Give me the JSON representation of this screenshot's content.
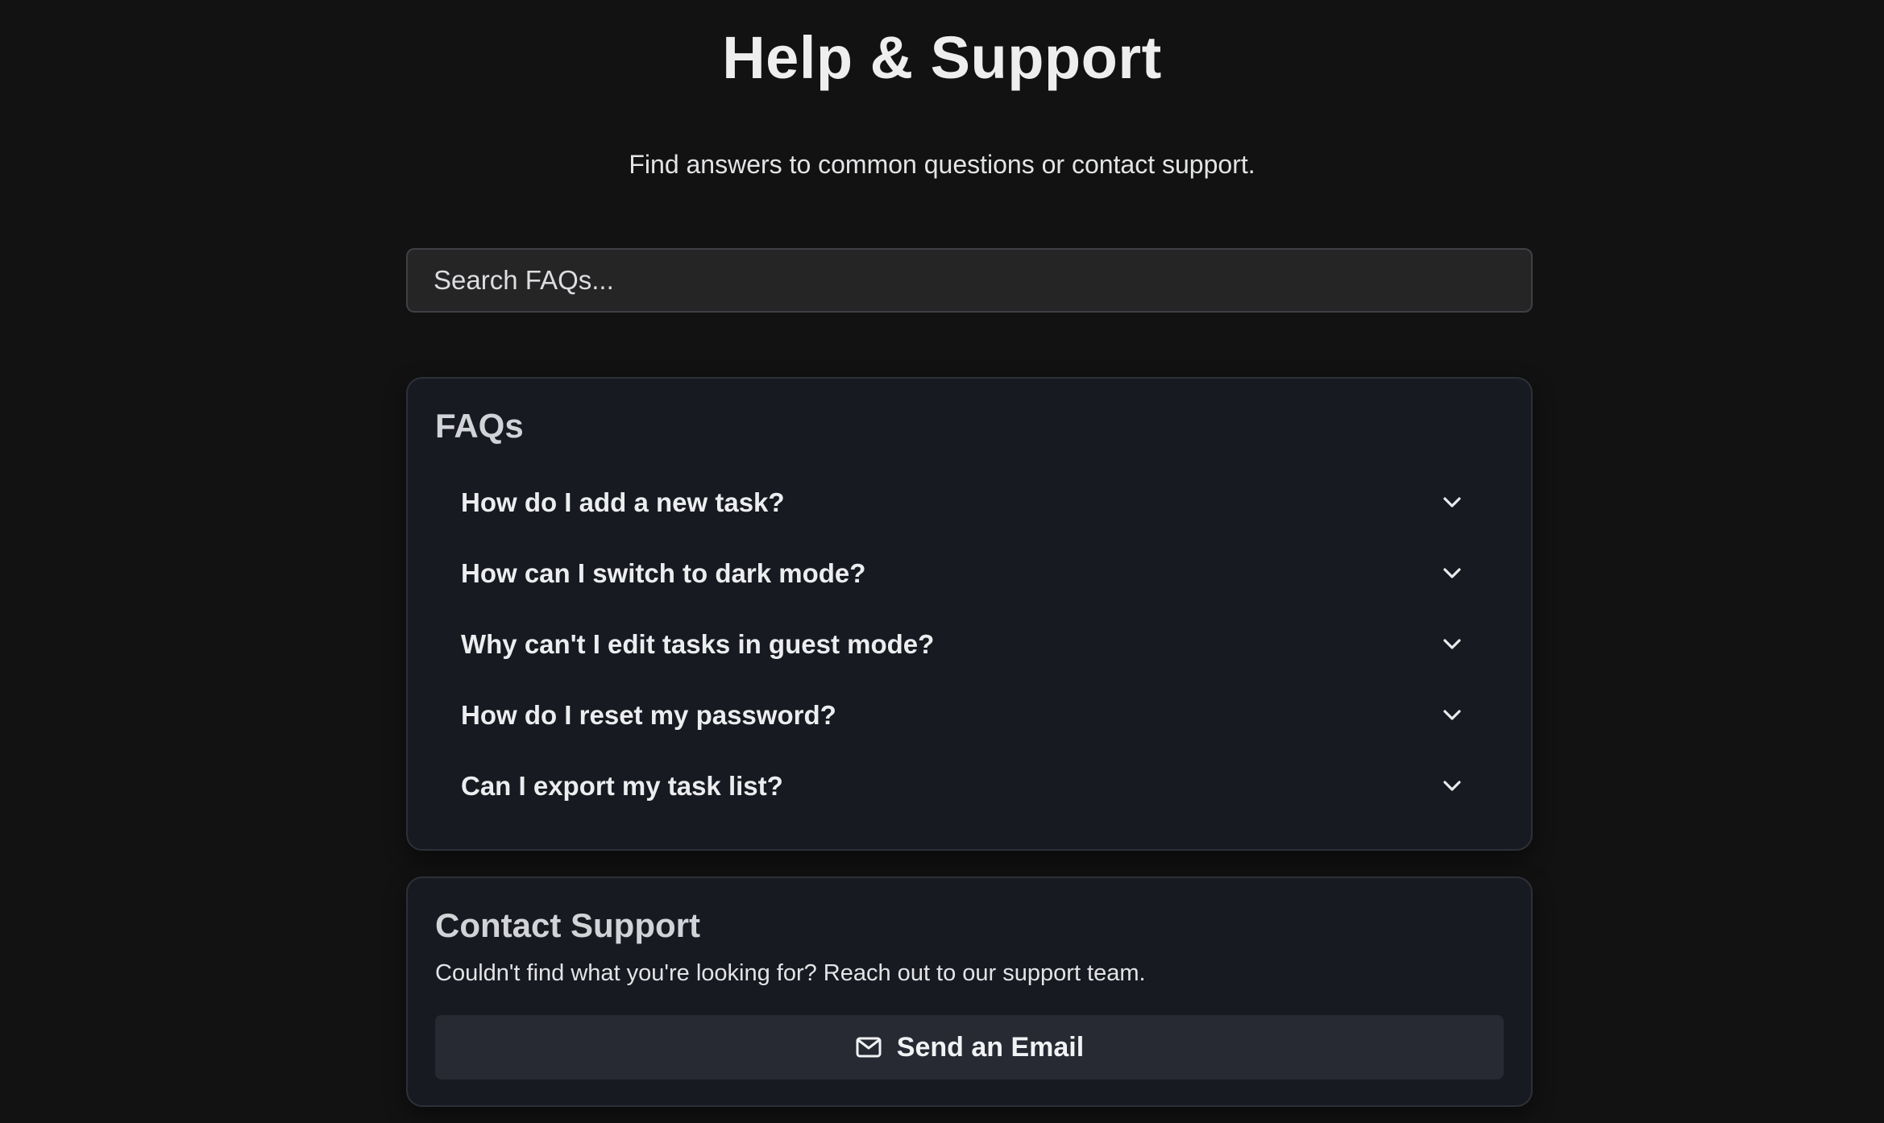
{
  "header": {
    "title": "Help & Support",
    "subtitle": "Find answers to common questions or contact support."
  },
  "search": {
    "placeholder": "Search FAQs...",
    "value": ""
  },
  "faq": {
    "heading": "FAQs",
    "items": [
      {
        "question": "How do I add a new task?",
        "icon": "chevron-down-icon"
      },
      {
        "question": "How can I switch to dark mode?",
        "icon": "chevron-down-icon"
      },
      {
        "question": "Why can't I edit tasks in guest mode?",
        "icon": "chevron-down-icon"
      },
      {
        "question": "How do I reset my password?",
        "icon": "chevron-down-icon"
      },
      {
        "question": "Can I export my task list?",
        "icon": "chevron-down-icon"
      }
    ]
  },
  "contact": {
    "heading": "Contact Support",
    "text": "Couldn't find what you're looking for? Reach out to our support team.",
    "button_label": "Send an Email",
    "button_icon": "mail-icon"
  },
  "colors": {
    "background": "#121212",
    "card": "#181a21",
    "button": "#272a33",
    "text": "#e9eaec"
  }
}
